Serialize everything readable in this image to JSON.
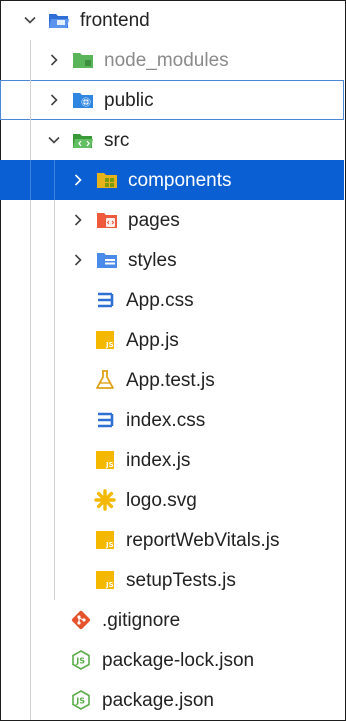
{
  "explorer": {
    "items": [
      {
        "label": "frontend",
        "icon": "folder-open-icon"
      },
      {
        "label": "node_modules",
        "icon": "folder-icon"
      },
      {
        "label": "public",
        "icon": "folder-icon"
      },
      {
        "label": "src",
        "icon": "folder-open-icon"
      },
      {
        "label": "components",
        "icon": "folder-icon"
      },
      {
        "label": "pages",
        "icon": "folder-icon"
      },
      {
        "label": "styles",
        "icon": "folder-icon"
      },
      {
        "label": "App.css",
        "icon": "css-file-icon"
      },
      {
        "label": "App.js",
        "icon": "js-file-icon"
      },
      {
        "label": "App.test.js",
        "icon": "test-file-icon"
      },
      {
        "label": "index.css",
        "icon": "css-file-icon"
      },
      {
        "label": "index.js",
        "icon": "js-file-icon"
      },
      {
        "label": "logo.svg",
        "icon": "svg-file-icon"
      },
      {
        "label": "reportWebVitals.js",
        "icon": "js-file-icon"
      },
      {
        "label": "setupTests.js",
        "icon": "js-file-icon"
      },
      {
        "label": ".gitignore",
        "icon": "git-icon"
      },
      {
        "label": "package-lock.json",
        "icon": "json-file-icon"
      },
      {
        "label": "package.json",
        "icon": "json-file-icon"
      }
    ]
  },
  "colors": {
    "selection": "#0a60d2",
    "focus_outline": "#4a86d8",
    "frontend_folder": "#2f6fd6",
    "node_modules_folder": "#5ab55a",
    "public_folder": "#2f86e0",
    "src_folder": "#3a9a3a",
    "components_folder": "#e5b21a",
    "pages_folder": "#f05a3c",
    "styles_folder": "#4a8ae8",
    "css": "#2f6fd6",
    "js": "#f5b800",
    "test": "#e0a21a",
    "svg": "#f5b800",
    "git": "#e5532d",
    "json": "#5aab4a"
  }
}
